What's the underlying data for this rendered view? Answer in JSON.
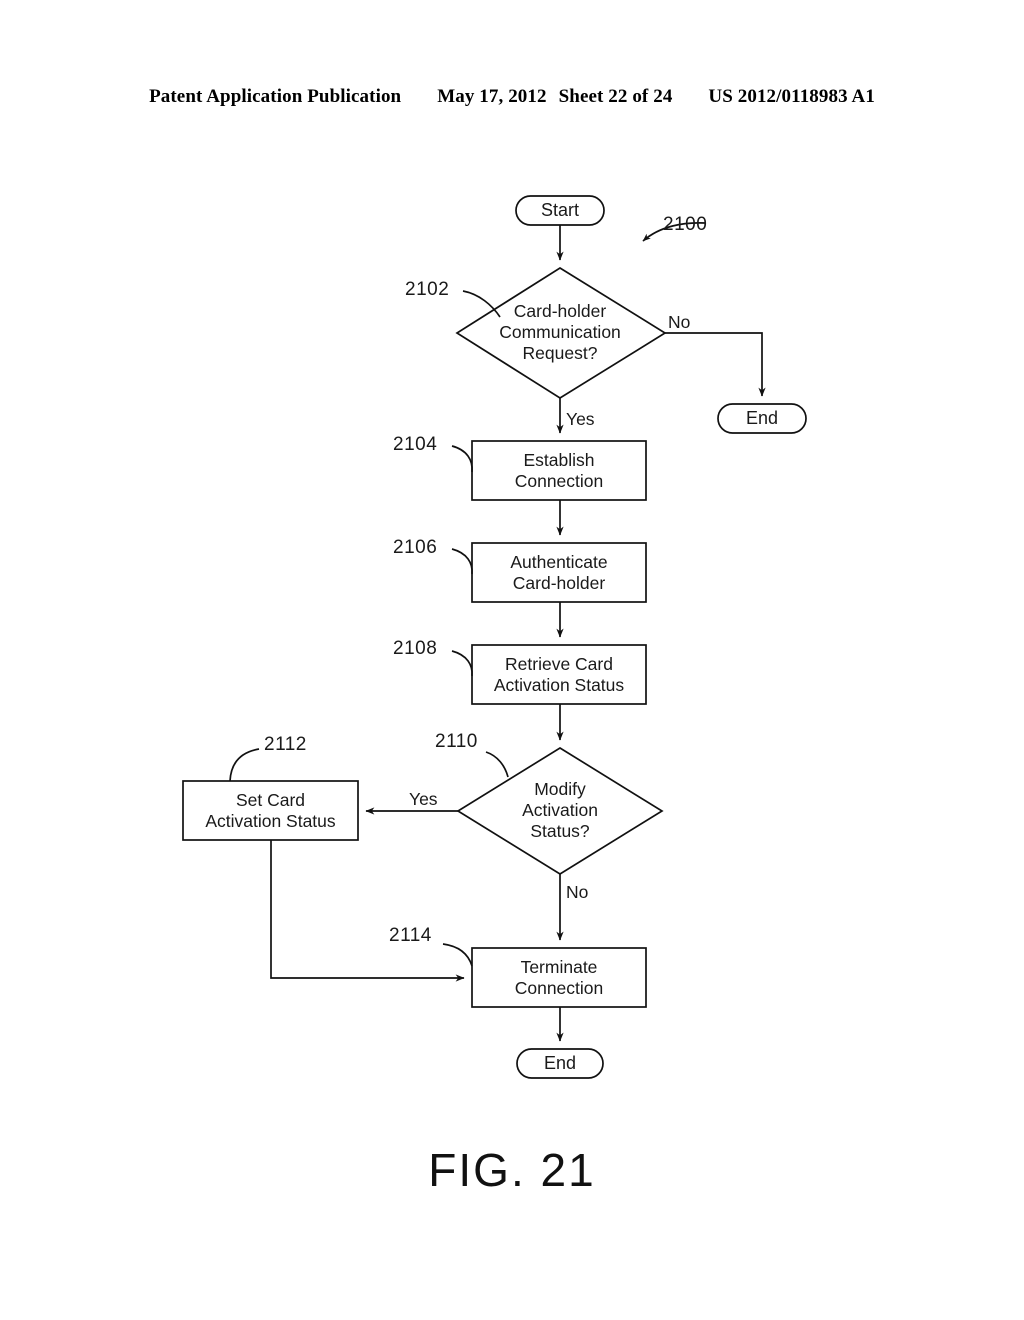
{
  "header": {
    "publication": "Patent Application Publication",
    "date": "May 17, 2012",
    "sheet": "Sheet 22 of 24",
    "doc_number": "US 2012/0118983 A1"
  },
  "figure": {
    "caption": "FIG. 21",
    "diagram_ref": "2100"
  },
  "chart_data": {
    "type": "diagram",
    "subtype": "flowchart",
    "title": "FIG. 21",
    "diagram_ref": "2100",
    "nodes": [
      {
        "id": "start",
        "ref": "",
        "shape": "terminator",
        "label": "Start"
      },
      {
        "id": "n2102",
        "ref": "2102",
        "shape": "decision",
        "label": "Card-holder\nCommunication\nRequest?"
      },
      {
        "id": "end_right",
        "ref": "",
        "shape": "terminator",
        "label": "End"
      },
      {
        "id": "n2104",
        "ref": "2104",
        "shape": "process",
        "label": "Establish\nConnection"
      },
      {
        "id": "n2106",
        "ref": "2106",
        "shape": "process",
        "label": "Authenticate\nCard-holder"
      },
      {
        "id": "n2108",
        "ref": "2108",
        "shape": "process",
        "label": "Retrieve  Card\nActivation  Status"
      },
      {
        "id": "n2110",
        "ref": "2110",
        "shape": "decision",
        "label": "Modify\nActivation\nStatus?"
      },
      {
        "id": "n2112",
        "ref": "2112",
        "shape": "process",
        "label": "Set  Card\nActivation  Status"
      },
      {
        "id": "n2114",
        "ref": "2114",
        "shape": "process",
        "label": "Terminate\nConnection"
      },
      {
        "id": "end_bottom",
        "ref": "",
        "shape": "terminator",
        "label": "End"
      }
    ],
    "edges": [
      {
        "from": "start",
        "to": "n2102",
        "label": ""
      },
      {
        "from": "n2102",
        "to": "end_right",
        "label": "No"
      },
      {
        "from": "n2102",
        "to": "n2104",
        "label": "Yes"
      },
      {
        "from": "n2104",
        "to": "n2106",
        "label": ""
      },
      {
        "from": "n2106",
        "to": "n2108",
        "label": ""
      },
      {
        "from": "n2108",
        "to": "n2110",
        "label": ""
      },
      {
        "from": "n2110",
        "to": "n2112",
        "label": "Yes"
      },
      {
        "from": "n2110",
        "to": "n2114",
        "label": "No"
      },
      {
        "from": "n2112",
        "to": "n2114",
        "label": ""
      },
      {
        "from": "n2114",
        "to": "end_bottom",
        "label": ""
      }
    ],
    "ref_labels": [
      "2100",
      "2102",
      "2104",
      "2106",
      "2108",
      "2110",
      "2112",
      "2114"
    ],
    "edge_labels": [
      "No",
      "Yes",
      "Yes",
      "No"
    ],
    "colors": {
      "stroke": "#111111",
      "fill": "#ffffff",
      "text": "#1a1a1a"
    }
  }
}
